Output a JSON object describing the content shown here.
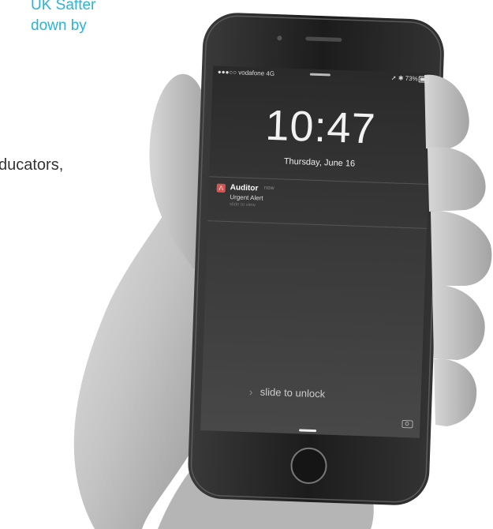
{
  "page": {
    "heading_blue": [
      "UK Safter",
      "down by"
    ],
    "body_fragment": "ducators,"
  },
  "phone": {
    "status_bar": {
      "carrier": "●●●○○ vodafone 4G",
      "right": "➚ ✱ 73%"
    },
    "lock_screen": {
      "time": "10:47",
      "date": "Thursday, June 16",
      "notification": {
        "app_icon": "auditor-app-icon",
        "app": "Auditor",
        "time": "now",
        "message": "Urgent Alert",
        "action": "slide to view"
      },
      "unlock_text": "slide to unlock",
      "icons": [
        "chevron-right-icon",
        "camera-icon",
        "battery-icon",
        "home-button-icon",
        "speaker-icon"
      ]
    }
  },
  "colors": {
    "accent_blue": "#2bb3d8",
    "notification_red": "#d9534f"
  }
}
